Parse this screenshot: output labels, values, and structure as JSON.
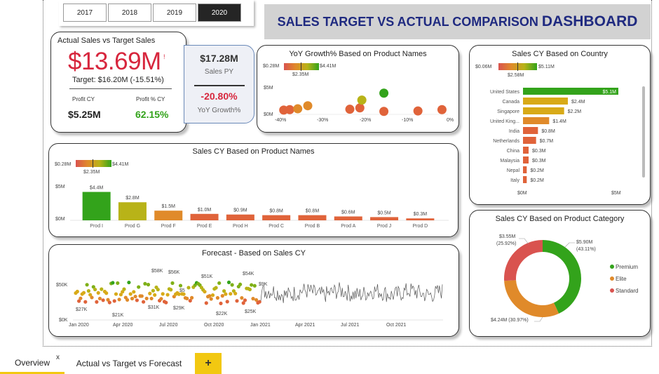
{
  "years": [
    "2017",
    "2018",
    "2019",
    "2020"
  ],
  "selected_year": "2020",
  "dashboard_title": {
    "main": "SALES TARGET VS ACTUAL COMPARISON ",
    "emph": "DASHBOARD"
  },
  "kpi": {
    "title": "Actual Sales vs Target Sales",
    "actual": "$13.69M",
    "alert_mark": "!",
    "target_text": "Target: $16.20M (-15.51%)",
    "profit_cy_label": "Profit CY",
    "profit_cy": "$5.25M",
    "profit_pct_label": "Profit % CY",
    "profit_pct": "62.15%"
  },
  "py": {
    "sales_py": "$17.28M",
    "sales_py_label": "Sales PY",
    "yoy": "-20.80%",
    "yoy_label": "YoY Growth%"
  },
  "colors": {
    "red": "#d9534f",
    "green": "#33a31b",
    "orange": "#e08a2a",
    "olive": "#b8b318",
    "title_blue": "#1f2a80",
    "neg": "#d7263d"
  },
  "yoy_chart": {
    "title": "YoY Growth% Based on Product Names",
    "grad_min": "$0.28M",
    "grad_mid": "$2.35M",
    "grad_max": "$4.41M",
    "y_ticks": [
      "$5M",
      "$0M"
    ],
    "x_ticks": [
      "-40%",
      "-30%",
      "-20%",
      "-10%",
      "0%"
    ]
  },
  "country_chart": {
    "title": "Sales CY Based on Country",
    "grad_min": "$0.06M",
    "grad_mid": "$2.58M",
    "grad_max": "$5.11M",
    "x_ticks": [
      "$0M",
      "$5M"
    ]
  },
  "product_chart": {
    "title": "Sales CY Based on Product Names",
    "grad_min": "$0.28M",
    "grad_mid": "$2.35M",
    "grad_max": "$4.41M",
    "y_ticks": [
      "$5M",
      "$0M"
    ]
  },
  "forecast_chart": {
    "title": "Forecast - Based on Sales CY",
    "y_ticks": [
      "$50K",
      "$0K"
    ],
    "x_ticks": [
      "Jan 2020",
      "Apr 2020",
      "Jul 2020",
      "Oct 2020",
      "Jan 2021",
      "Apr 2021",
      "Jul 2021",
      "Oct 2021"
    ],
    "annotations": [
      "$58K",
      "$56K",
      "$51K",
      "$54K",
      "$27K",
      "$21K",
      "$31K",
      "$29K",
      "$22K",
      "$25K",
      "$5",
      "$9K"
    ]
  },
  "category_chart": {
    "title": "Sales CY Based on Product Category",
    "legend": [
      "Premium",
      "Elite",
      "Standard"
    ],
    "labels": {
      "premium_val": "$5.90M",
      "premium_pct": "(43.11%)",
      "elite": "$4.24M (30.97%)",
      "standard_val": "$3.55M",
      "standard_pct": "(25.92%)"
    }
  },
  "tabs": {
    "overview": "Overview",
    "close": "x",
    "second": "Actual vs Target vs Forecast",
    "add": "+"
  },
  "chart_data": [
    {
      "type": "bar",
      "title": "Sales CY Based on Product Names",
      "categories": [
        "Prod I",
        "Prod G",
        "Prod F",
        "Prod E",
        "Prod H",
        "Prod C",
        "Prod B",
        "Prod A",
        "Prod J",
        "Prod D"
      ],
      "values": [
        4.4,
        2.8,
        1.5,
        1.0,
        0.9,
        0.8,
        0.8,
        0.6,
        0.5,
        0.3
      ],
      "labels": [
        "$4.4M",
        "$2.8M",
        "$1.5M",
        "$1.0M",
        "$0.9M",
        "$0.8M",
        "$0.8M",
        "$0.6M",
        "$0.5M",
        "$0.3M"
      ],
      "colors": [
        "#33a31b",
        "#b8b318",
        "#e08a2a",
        "#e0633a",
        "#e0633a",
        "#e0633a",
        "#e0633a",
        "#e0633a",
        "#e0633a",
        "#e0633a"
      ],
      "ylim": [
        0,
        5
      ]
    },
    {
      "type": "bar",
      "orientation": "horizontal",
      "title": "Sales CY Based on Country",
      "categories": [
        "United States",
        "Canada",
        "Singapore",
        "United King...",
        "India",
        "Netherlands",
        "China",
        "Malaysia",
        "Nepal",
        "Italy"
      ],
      "values": [
        5.1,
        2.4,
        2.2,
        1.4,
        0.8,
        0.7,
        0.3,
        0.3,
        0.2,
        0.2
      ],
      "labels": [
        "$5.1M",
        "$2.4M",
        "$2.2M",
        "$1.4M",
        "$0.8M",
        "$0.7M",
        "$0.3M",
        "$0.3M",
        "$0.2M",
        "$0.2M"
      ],
      "colors": [
        "#33a31b",
        "#d8aa18",
        "#d8aa18",
        "#e08a2a",
        "#e0633a",
        "#e0633a",
        "#e0633a",
        "#e0633a",
        "#e0633a",
        "#e0633a"
      ],
      "xlim": [
        0,
        5.5
      ]
    },
    {
      "type": "scatter",
      "title": "YoY Growth% Based on Product Names",
      "points": [
        {
          "x": -41,
          "y": 0.5,
          "color": "#e0633a"
        },
        {
          "x": -39.5,
          "y": 0.6,
          "color": "#e0633a"
        },
        {
          "x": -37.5,
          "y": 0.8,
          "color": "#e08a2a"
        },
        {
          "x": -35,
          "y": 1.5,
          "color": "#e08a2a"
        },
        {
          "x": -24.5,
          "y": 0.7,
          "color": "#e0633a"
        },
        {
          "x": -22,
          "y": 1.0,
          "color": "#e0633a"
        },
        {
          "x": -21.5,
          "y": 2.8,
          "color": "#b8b318"
        },
        {
          "x": -16,
          "y": 4.4,
          "color": "#33a31b"
        },
        {
          "x": -16,
          "y": 0.2,
          "color": "#e0633a"
        },
        {
          "x": -7.5,
          "y": 0.3,
          "color": "#e0633a"
        },
        {
          "x": -1.5,
          "y": 0.6,
          "color": "#e0633a"
        }
      ],
      "xlim": [
        -42,
        0
      ],
      "ylim": [
        0,
        5
      ]
    },
    {
      "type": "pie",
      "title": "Sales CY Based on Product Category",
      "categories": [
        "Premium",
        "Elite",
        "Standard"
      ],
      "values": [
        5.9,
        4.24,
        3.55
      ],
      "percent": [
        43.11,
        30.97,
        25.92
      ],
      "colors": [
        "#33a31b",
        "#e08a2a",
        "#d9534f"
      ],
      "donut": true
    }
  ]
}
